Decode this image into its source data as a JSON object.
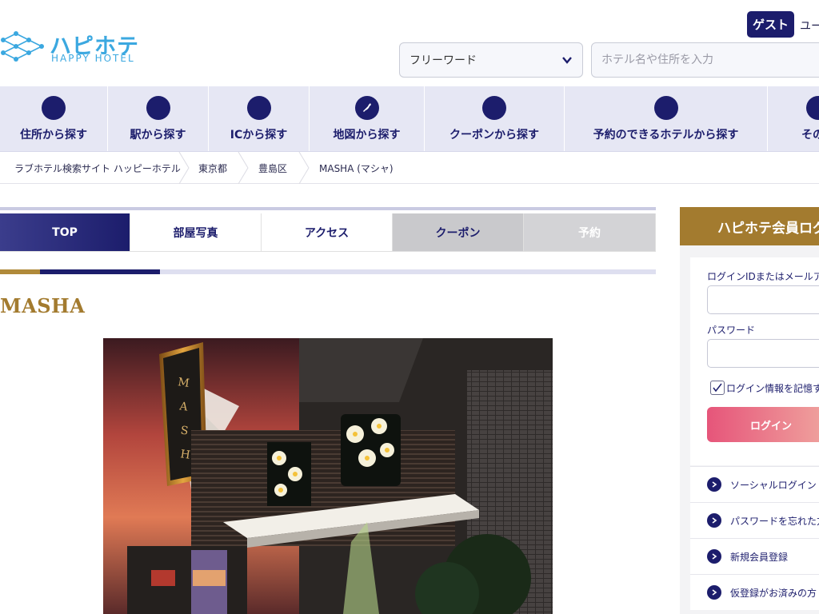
{
  "header": {
    "logo_ja": "ハピホテ",
    "logo_en": "HAPPY HOTEL",
    "guest_badge": "ゲスト",
    "user_text": "ユー",
    "search": {
      "select_value": "フリーワード",
      "input_placeholder": "ホテル名や住所を入力"
    }
  },
  "nav": {
    "items": [
      {
        "label": "住所から探す",
        "icon": "circle-icon"
      },
      {
        "label": "駅から探す",
        "icon": "circle-icon"
      },
      {
        "label": "ICから探す",
        "icon": "circle-icon"
      },
      {
        "label": "地図から探す",
        "icon": "japan-map-icon"
      },
      {
        "label": "クーポンから探す",
        "icon": "circle-icon"
      },
      {
        "label": "予約のできるホテルから探す",
        "icon": "circle-icon"
      },
      {
        "label": "その他",
        "icon": "circle-icon"
      }
    ]
  },
  "breadcrumb": [
    "ラブホテル検索サイト ハッピーホテル",
    "東京都",
    "豊島区",
    "MASHA (マシャ)"
  ],
  "tabs": {
    "top": "TOP",
    "rooms": "部屋写真",
    "access": "アクセス",
    "coupon": "クーポン",
    "reserve": "予約"
  },
  "hotel": {
    "name": "MASHA",
    "sign_text": "MASHA IN"
  },
  "login": {
    "title": "ハピホテ会員ログ",
    "id_label": "ログインIDまたはメールアドレ",
    "password_label": "パスワード",
    "remember_label": "ログイン情報を記憶す",
    "remember_checked": true,
    "button_label": "ログイン",
    "links": [
      "ソーシャルログイン",
      "パスワードを忘れた方",
      "新規会員登録",
      "仮登録がお済みの方"
    ]
  },
  "colors": {
    "navy": "#1c1d6c",
    "gold": "#a37b2f",
    "logo_blue": "#3ba8e0",
    "nav_bg": "#e6e7f4"
  }
}
